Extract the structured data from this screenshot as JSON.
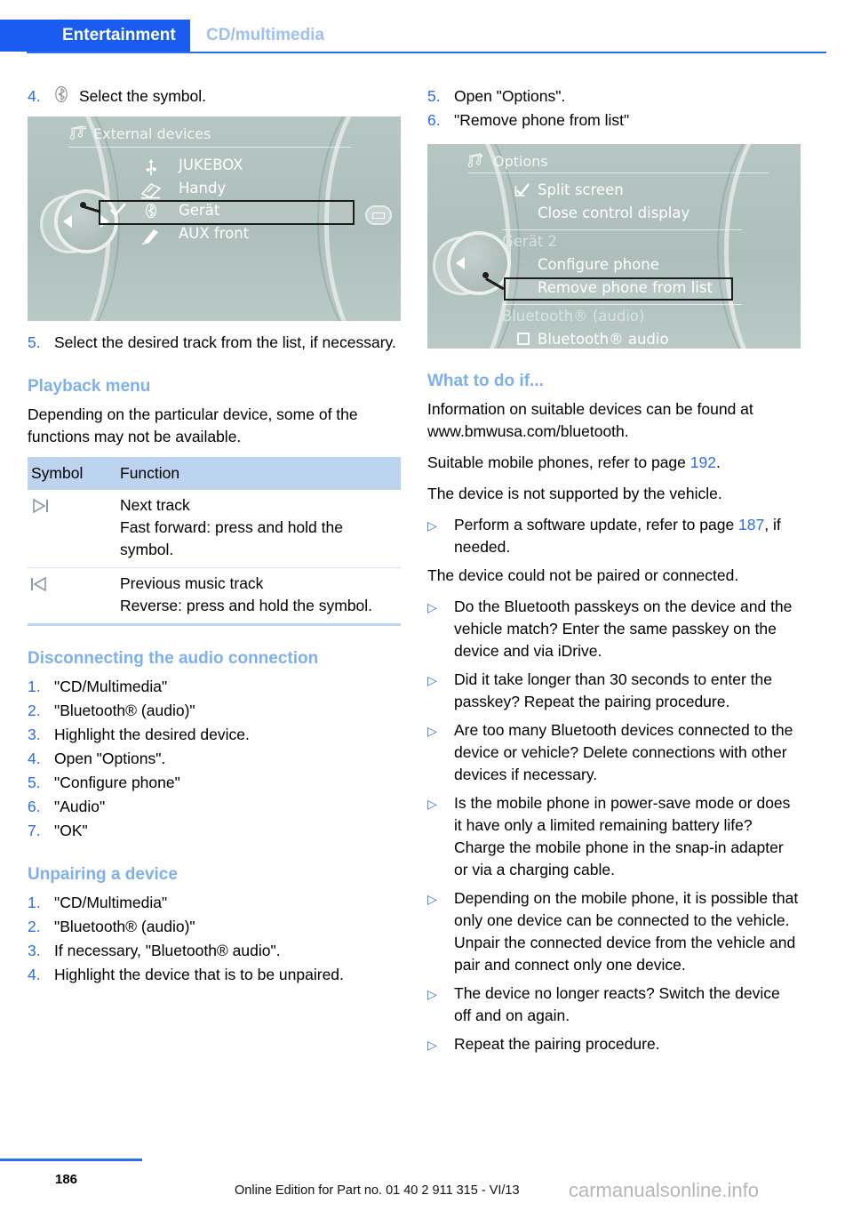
{
  "header": {
    "active_tab": "Entertainment",
    "inactive_tab": "CD/multimedia"
  },
  "left_column": {
    "step4": {
      "num": "4.",
      "symbol": "bluetooth-symbol",
      "text": "Select the symbol."
    },
    "screenshot1": {
      "title": "External devices",
      "title_icon": "multimedia-icon",
      "rows": [
        {
          "icon": "usb-icon",
          "label": "JUKEBOX",
          "checked": false,
          "highlighted": false
        },
        {
          "icon": "phone-icon",
          "label": "Handy",
          "checked": false,
          "highlighted": false
        },
        {
          "icon": "bluetooth-icon",
          "label": "Gerät",
          "checked": true,
          "highlighted": true
        },
        {
          "icon": "aux-jack-icon",
          "label": "AUX front",
          "checked": false,
          "highlighted": false
        }
      ]
    },
    "step5": {
      "num": "5.",
      "text": "Select the desired track from the list, if necessary."
    },
    "playback": {
      "heading": "Playback menu",
      "intro": "Depending on the particular device, some of the functions may not be available.",
      "table": {
        "headers": [
          "Symbol",
          "Function"
        ],
        "rows": [
          {
            "symbol": "next-track-icon",
            "symbol_glyph": "▷|",
            "lines": [
              "Next track",
              "Fast forward: press and hold the symbol."
            ]
          },
          {
            "symbol": "previous-track-icon",
            "symbol_glyph": "|◁",
            "lines": [
              "Previous music track",
              "Reverse: press and hold the symbol."
            ]
          }
        ]
      }
    },
    "disconnecting": {
      "heading": "Disconnecting the audio connection",
      "steps": [
        {
          "num": "1.",
          "text": "\"CD/Multimedia\""
        },
        {
          "num": "2.",
          "text": "\"Bluetooth® (audio)\""
        },
        {
          "num": "3.",
          "text": "Highlight the desired device."
        },
        {
          "num": "4.",
          "text": "Open \"Options\"."
        },
        {
          "num": "5.",
          "text": "\"Configure phone\""
        },
        {
          "num": "6.",
          "text": "\"Audio\""
        },
        {
          "num": "7.",
          "text": "\"OK\""
        }
      ]
    },
    "unpairing": {
      "heading": "Unpairing a device",
      "steps": [
        {
          "num": "1.",
          "text": "\"CD/Multimedia\""
        },
        {
          "num": "2.",
          "text": "\"Bluetooth® (audio)\""
        },
        {
          "num": "3.",
          "text": "If necessary, \"Bluetooth® audio\"."
        },
        {
          "num": "4.",
          "text": "Highlight the device that is to be unpaired."
        }
      ]
    }
  },
  "right_column": {
    "steps": [
      {
        "num": "5.",
        "text": "Open \"Options\"."
      },
      {
        "num": "6.",
        "text": "\"Remove phone from list\""
      }
    ],
    "screenshot2": {
      "title": "Options",
      "title_icon": "multimedia-plus-icon",
      "rows": [
        {
          "icon": "checkbox-checked-icon",
          "label": "Split screen",
          "type": "item"
        },
        {
          "icon": "",
          "label": "Close control display",
          "type": "item"
        },
        {
          "icon": "",
          "label": "Gerät 2",
          "type": "group"
        },
        {
          "icon": "",
          "label": "Configure phone",
          "type": "item"
        },
        {
          "icon": "",
          "label": "Remove phone from list",
          "type": "item-highlighted"
        },
        {
          "icon": "",
          "label": "Bluetooth® (audio)",
          "type": "group"
        },
        {
          "icon": "checkbox-empty-icon",
          "label": "Bluetooth® audio",
          "type": "item"
        }
      ]
    },
    "what_to_do": {
      "heading": "What to do if...",
      "paragraphs": [
        "Information on suitable devices can be found at www.bmwusa.com/bluetooth.",
        "The device is not supported by the vehicle.",
        "The device could not be paired or connected."
      ],
      "page_ref_line": {
        "before": "Suitable mobile phones, refer to page ",
        "page": "192",
        "after": "."
      },
      "bullets_after_unsupported": [
        {
          "before": "Perform a software update, refer to page ",
          "page": "187",
          "after": ", if needed."
        }
      ],
      "bullets_after_notpaired": [
        {
          "text": "Do the Bluetooth passkeys on the device and the vehicle match? Enter the same passkey on the device and via iDrive."
        },
        {
          "text": "Did it take longer than 30 seconds to enter the passkey? Repeat the pairing procedure."
        },
        {
          "text": "Are too many Bluetooth devices connected to the device or vehicle? Delete connections with other devices if necessary."
        },
        {
          "text": "Is the mobile phone in power-save mode or does it have only a limited remaining battery life? Charge the mobile phone in the snap-in adapter or via a charging cable."
        },
        {
          "text": "Depending on the mobile phone, it is possible that only one device can be connected to the vehicle. Unpair the connected device from the vehicle and pair and connect only one device."
        },
        {
          "text": "The device no longer reacts? Switch the device off and on again."
        },
        {
          "text": "Repeat the pairing procedure."
        }
      ]
    }
  },
  "footer": {
    "page_number": "186",
    "edition": "Online Edition for Part no. 01 40 2 911 315 - VI/13",
    "watermark": "carmanualsonline.info"
  },
  "colors": {
    "accent_blue": "#2a6ef0",
    "tab_blue": "#1a5cf0",
    "heading_blue": "#7fb0ee",
    "table_header": "#bcd4ef",
    "screen_bg": "#aebfbb"
  }
}
